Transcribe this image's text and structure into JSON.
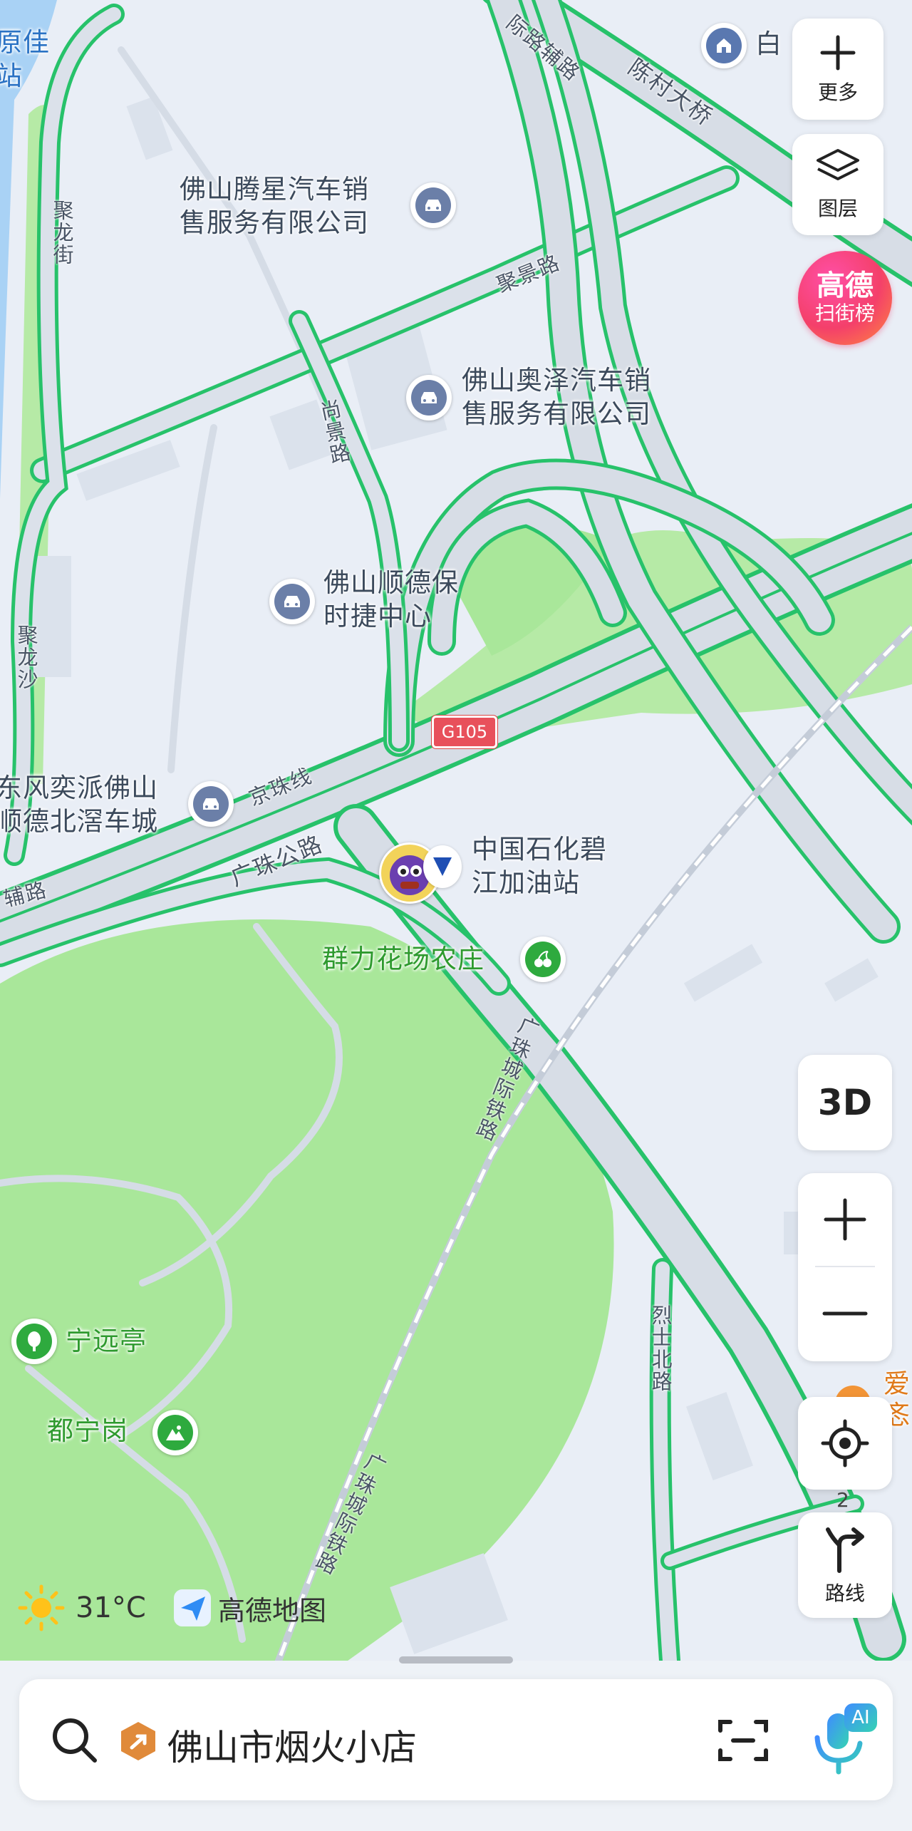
{
  "map": {
    "places": {
      "tengxing": "佛山腾星汽车销\n售服务有限公司",
      "aoze": "佛山奥泽汽车销\n售服务有限公司",
      "porsche": "佛山顺德保\n时捷中心",
      "dongfeng": "东风奕派佛山\n顺德北滘车城",
      "sinopec": "中国石化碧\n江加油站",
      "qunli": "群力花场农庄",
      "ningyuan": "宁远亭",
      "duning": "都宁岗",
      "yuanjia": "原佳\n站",
      "bai": "白",
      "ai": "爱\n忞"
    },
    "roads": {
      "chencun_bridge": "陈村大桥",
      "rail_aux": "际路辅路",
      "jujing": "聚景路",
      "shangjing": "尚景路",
      "julong_st": "聚龙街",
      "julongsha": "聚龙沙",
      "jingzhu": "京珠线",
      "guangzhu": "广珠公路",
      "fulu": "辅路",
      "guangzhu_rail": "广珠城际铁路",
      "guangzhu_rail_2": "广珠城际铁路",
      "lieshi": "烈士北路",
      "g105": "G105"
    }
  },
  "controls": {
    "more_label": "更多",
    "layers_label": "图层",
    "ranking_title": "高德",
    "ranking_sub": "扫街榜",
    "three_d": "3D",
    "route_label": "路线",
    "route_num": "2"
  },
  "weather": {
    "temp": "31°C",
    "brand": "高德地图"
  },
  "search": {
    "placeholder": "佛山市烟火小店",
    "voice_badge": "AI"
  },
  "colors": {
    "road_green": "#27c26a",
    "park": "#a9e79a",
    "map_bg": "#e9eef6"
  }
}
